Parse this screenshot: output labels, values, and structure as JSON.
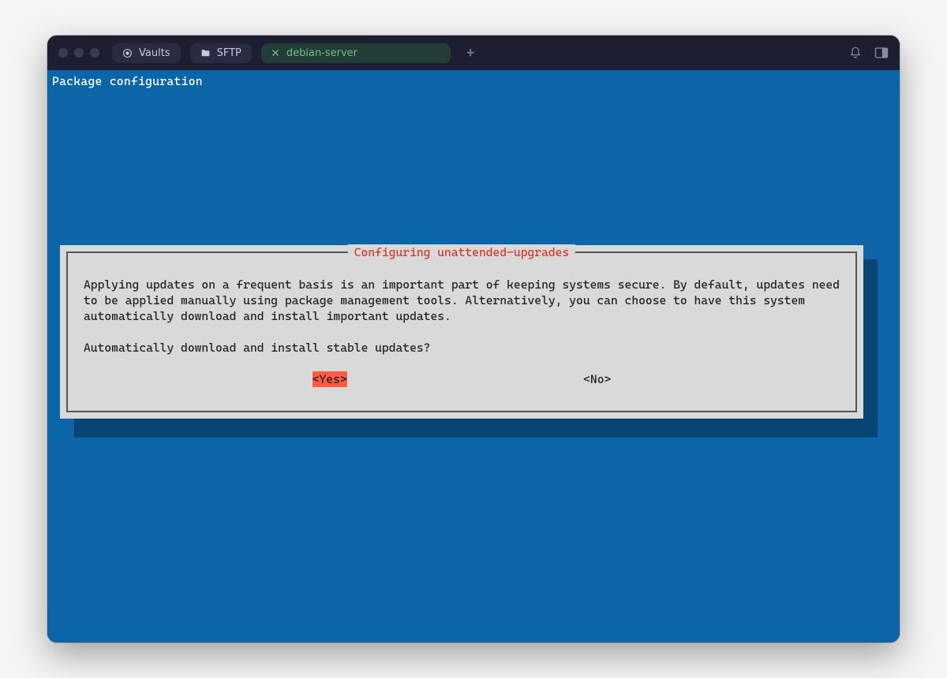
{
  "titlebar": {
    "tabs": [
      {
        "label": "Vaults",
        "icon": "record-icon"
      },
      {
        "label": "SFTP",
        "icon": "folder-icon"
      }
    ],
    "active_tab": {
      "label": "debian-server",
      "close_icon": "close-icon"
    },
    "new_tab_glyph": "+"
  },
  "terminal": {
    "header": "Package configuration"
  },
  "dialog": {
    "title": "Configuring unattended-upgrades",
    "body": "Applying updates on a frequent basis is an important part of keeping systems secure. By default, updates need to be applied manually using package management tools. Alternatively, you can choose to have this system automatically download and install important updates.",
    "question": "Automatically download and install stable updates?",
    "yes_label": "<Yes>",
    "no_label": "<No>"
  }
}
